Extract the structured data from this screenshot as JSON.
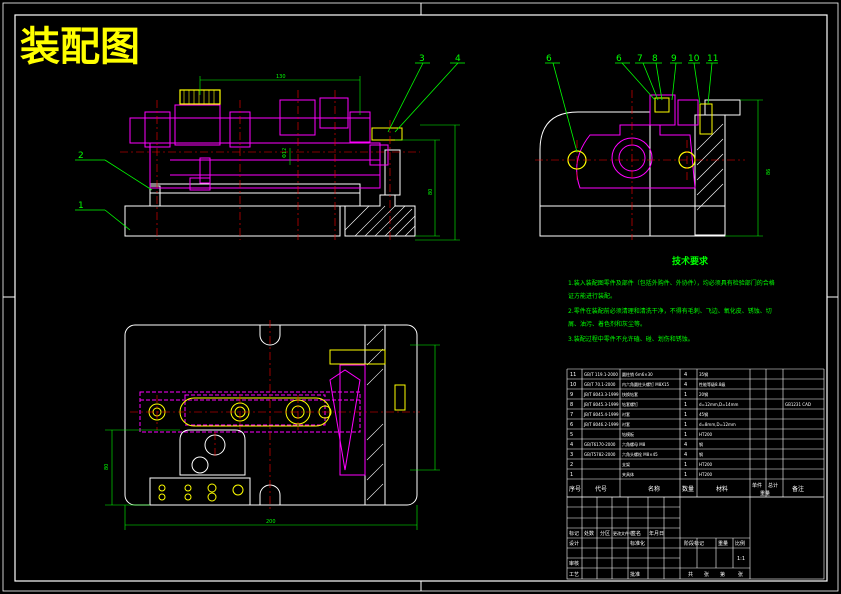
{
  "title": "装配图",
  "tech": {
    "heading": "技术要求",
    "lines": [
      "1.装入装配图零件及部件（包括外购件、外协件），均必须具有检验部门的合格",
      "证方能进行装配。",
      "2.零件在装配前必须清理和清洗干净，不得有毛刺、飞边、氧化皮、锈蚀、切",
      "屑、油污、着色剂和灰尘等。",
      "3.装配过程中零件不允许磕、碰、划伤和锈蚀。"
    ]
  },
  "callouts": [
    "1",
    "2",
    "3",
    "4",
    "6",
    "7",
    "8",
    "9",
    "10",
    "11"
  ],
  "bom": {
    "header": {
      "seq": "序号",
      "code": "代号",
      "name": "名称",
      "qty": "数量",
      "material": "材料",
      "weight_single": "单件",
      "weight_total": "总计",
      "weight": "重量",
      "note": "备注"
    },
    "rows": [
      {
        "seq": "11",
        "code": "GB/T 119.1-2000",
        "name": "圆柱销 6m6×30",
        "qty": "4",
        "material": "35钢",
        "note": ""
      },
      {
        "seq": "10",
        "code": "GB/T 70.1-2000",
        "name": "内六角圆柱头螺钉 M8X15",
        "qty": "4",
        "material": "性能等级8.8级",
        "note": ""
      },
      {
        "seq": "9",
        "code": "JB/T 8043.3-1999",
        "name": "快换钻套",
        "qty": "1",
        "material": "20钢",
        "note": ""
      },
      {
        "seq": "8",
        "code": "JB/T 8045.3-1999",
        "name": "钻套螺钉",
        "qty": "1",
        "material": "d=12mm,D=14mm",
        "note": "GB1231 CAD"
      },
      {
        "seq": "7",
        "code": "JB/T 8045.4-1999",
        "name": "衬套",
        "qty": "1",
        "material": "45钢",
        "note": ""
      },
      {
        "seq": "6",
        "code": "JB/T 8046.2-1999",
        "name": "衬套",
        "qty": "1",
        "material": "d=8mm,D=12mm",
        "note": ""
      },
      {
        "seq": "5",
        "code": "",
        "name": "钻模板",
        "qty": "1",
        "material": "HT200",
        "note": ""
      },
      {
        "seq": "4",
        "code": "GB/T6170-2000",
        "name": "六角螺母 M8",
        "qty": "4",
        "material": "钢",
        "note": ""
      },
      {
        "seq": "3",
        "code": "GB/T5782-2000",
        "name": "六角头螺栓 M8×45",
        "qty": "4",
        "material": "钢",
        "note": ""
      },
      {
        "seq": "2",
        "code": "",
        "name": "支架",
        "qty": "1",
        "material": "HT200",
        "note": ""
      },
      {
        "seq": "1",
        "code": "",
        "name": "夹具体",
        "qty": "1",
        "material": "HT200",
        "note": ""
      }
    ]
  },
  "titleblock": {
    "r1": [
      "标记",
      "处数",
      "分区",
      "更改文件号",
      "签名",
      "年月日"
    ],
    "r2": [
      "设计",
      "",
      "标准化"
    ],
    "r3": [
      "审核"
    ],
    "r4": [
      "工艺",
      "",
      "批准"
    ],
    "stage": [
      "阶段标记",
      "重量",
      "比例"
    ],
    "scale": "1:1",
    "sheet": [
      "共",
      "张",
      "第",
      "张"
    ]
  },
  "dims": {
    "top_len": "130",
    "right_height": "80",
    "right_h2": "86",
    "bottom_len": "200",
    "left_v": "80",
    "center": "Φ12"
  },
  "colors": {
    "bg": "#000000",
    "white": "#ffffff",
    "magenta": "#ff00ff",
    "yellow": "#ffff00",
    "green": "#00ff00",
    "cyan": "#00ffff",
    "red": "#ff0000"
  }
}
